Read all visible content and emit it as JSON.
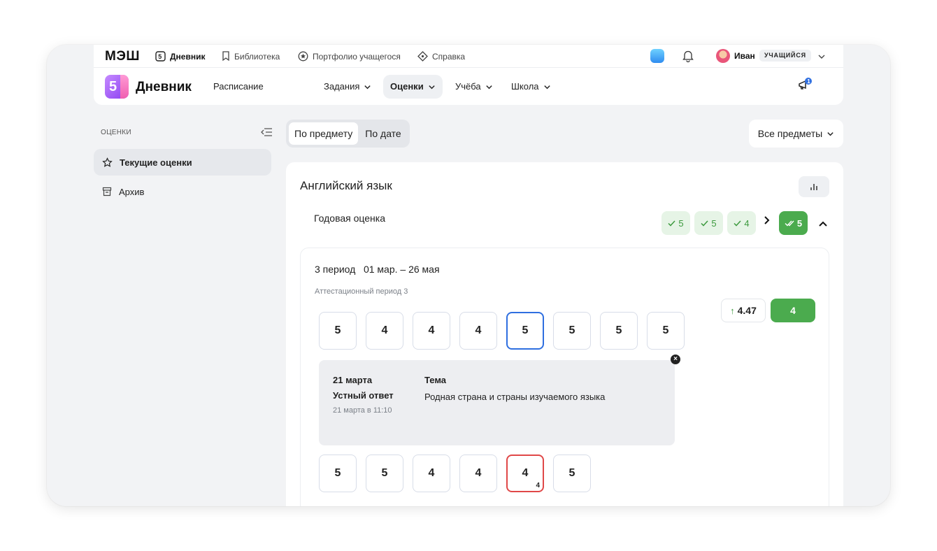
{
  "topbar": {
    "logo": "МЭШ",
    "links": [
      {
        "label": "Дневник",
        "icon": "diary-5-icon"
      },
      {
        "label": "Библиотека",
        "icon": "bookmark-icon"
      },
      {
        "label": "Портфолио учащегося",
        "icon": "star-circle-icon"
      },
      {
        "label": "Справка",
        "icon": "help-diamond-icon"
      }
    ],
    "user_name": "Иван",
    "user_role": "УЧАЩИЙСЯ"
  },
  "nav": {
    "brand_digit": "5",
    "brand_name": "Дневник",
    "items": [
      {
        "label": "Расписание",
        "dropdown": false,
        "active": false
      },
      {
        "label": "Задания",
        "dropdown": true,
        "active": false
      },
      {
        "label": "Оценки",
        "dropdown": true,
        "active": true
      },
      {
        "label": "Учёба",
        "dropdown": true,
        "active": false
      },
      {
        "label": "Школа",
        "dropdown": true,
        "active": false
      }
    ],
    "notification_count": "1"
  },
  "sidebar": {
    "title": "ОЦЕНКИ",
    "items": [
      {
        "label": "Текущие оценки",
        "icon": "star-outline-icon",
        "active": true
      },
      {
        "label": "Архив",
        "icon": "archive-icon",
        "active": false
      }
    ]
  },
  "view_switch": {
    "options": [
      "По предмету",
      "По дате"
    ],
    "selected": "По предмету"
  },
  "subject_filter": {
    "value": "Все предметы"
  },
  "subject": {
    "title": "Английский язык",
    "year_label": "Годовая оценка",
    "period_marks": [
      "5",
      "5",
      "4"
    ],
    "year_mark": "5"
  },
  "period": {
    "title": "3 период   01 мар. – 26 мая",
    "subtitle": "Аттестационный период 3",
    "average": "4.47",
    "grade": "4",
    "marks_row1": [
      "5",
      "4",
      "4",
      "4",
      "5",
      "5",
      "5",
      "5"
    ],
    "selected_index": 4,
    "marks_row2": [
      "5",
      "5",
      "4",
      "4",
      "4",
      "5"
    ],
    "row2_weight_index": 4,
    "row2_weight": "4"
  },
  "popup": {
    "date": "21 марта",
    "type": "Устный ответ",
    "time": "21 марта в 11:10",
    "topic_label": "Тема",
    "topic": "Родная страна и страны изучаемого языка",
    "close": "×"
  },
  "colors": {
    "accent_green": "#4bab4e",
    "light_green": "#e6f4e6",
    "selected_blue": "#2f6fe0",
    "highlight_red": "#e04848",
    "brand_purple": "#8a3df0"
  }
}
